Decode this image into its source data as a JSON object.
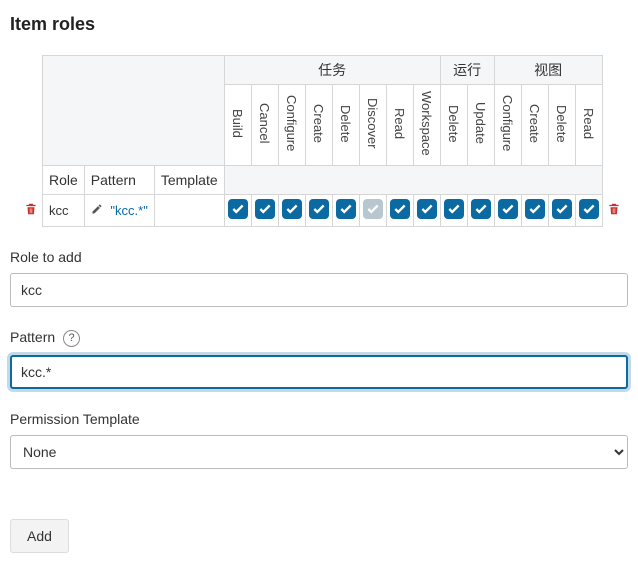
{
  "title": "Item roles",
  "table": {
    "groups": [
      {
        "label": "任务",
        "span": 8
      },
      {
        "label": "运行",
        "span": 2
      },
      {
        "label": "视图",
        "span": 4
      }
    ],
    "left_headers": {
      "role": "Role",
      "pattern": "Pattern",
      "template": "Template"
    },
    "perm_columns": [
      "Build",
      "Cancel",
      "Configure",
      "Create",
      "Delete",
      "Discover",
      "Read",
      "Workspace",
      "Delete",
      "Update",
      "Configure",
      "Create",
      "Delete",
      "Read"
    ],
    "row": {
      "role": "kcc",
      "pattern": "\"kcc.*\"",
      "checks": [
        1,
        1,
        1,
        1,
        1,
        0,
        1,
        1,
        1,
        1,
        1,
        1,
        1,
        1
      ]
    }
  },
  "fields": {
    "role_label": "Role to add",
    "role_value": "kcc",
    "pattern_label": "Pattern",
    "pattern_value": "kcc.*",
    "template_label": "Permission Template",
    "template_value": "None"
  },
  "buttons": {
    "add": "Add"
  },
  "help_symbol": "?"
}
